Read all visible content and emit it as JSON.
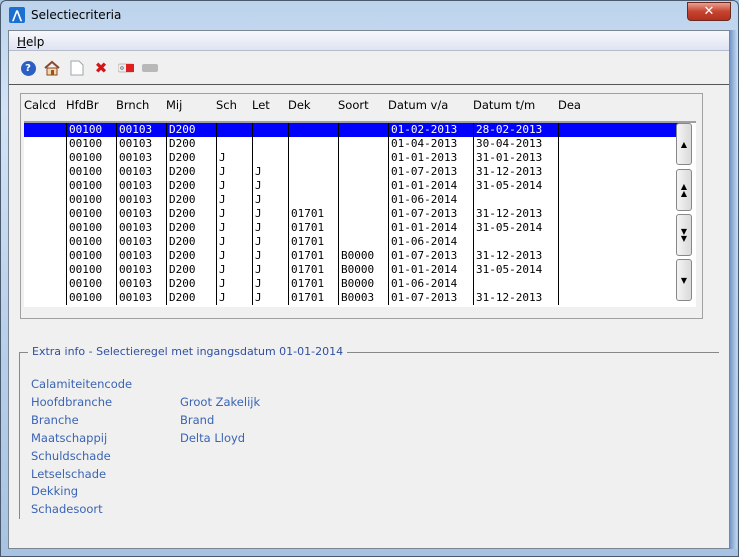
{
  "window": {
    "title": "Selectiecriteria",
    "close": "✕"
  },
  "menu": {
    "help": "Help"
  },
  "toolbar": [
    "help-icon",
    "home-icon",
    "new-document-icon",
    "delete-icon",
    "toggle-on-icon",
    "toggle-off-icon"
  ],
  "table": {
    "headers": [
      "Calcd",
      "HfdBr",
      "Brnch",
      "Mij",
      "Sch",
      "Let",
      "Dek",
      "Soort",
      "Datum v/a",
      "Datum t/m",
      "Dea"
    ],
    "rows": [
      [
        "",
        "00100",
        "00103",
        "D200",
        "",
        "",
        "",
        "",
        "01-02-2013",
        "28-02-2013",
        ""
      ],
      [
        "",
        "00100",
        "00103",
        "D200",
        "",
        "",
        "",
        "",
        "01-04-2013",
        "30-04-2013",
        ""
      ],
      [
        "",
        "00100",
        "00103",
        "D200",
        "J",
        "",
        "",
        "",
        "01-01-2013",
        "31-01-2013",
        ""
      ],
      [
        "",
        "00100",
        "00103",
        "D200",
        "J",
        "J",
        "",
        "",
        "01-07-2013",
        "31-12-2013",
        ""
      ],
      [
        "",
        "00100",
        "00103",
        "D200",
        "J",
        "J",
        "",
        "",
        "01-01-2014",
        "31-05-2014",
        ""
      ],
      [
        "",
        "00100",
        "00103",
        "D200",
        "J",
        "J",
        "",
        "",
        "01-06-2014",
        "",
        ""
      ],
      [
        "",
        "00100",
        "00103",
        "D200",
        "J",
        "J",
        "01701",
        "",
        "01-07-2013",
        "31-12-2013",
        ""
      ],
      [
        "",
        "00100",
        "00103",
        "D200",
        "J",
        "J",
        "01701",
        "",
        "01-01-2014",
        "31-05-2014",
        ""
      ],
      [
        "",
        "00100",
        "00103",
        "D200",
        "J",
        "J",
        "01701",
        "",
        "01-06-2014",
        "",
        ""
      ],
      [
        "",
        "00100",
        "00103",
        "D200",
        "J",
        "J",
        "01701",
        "B0000",
        "01-07-2013",
        "31-12-2013",
        ""
      ],
      [
        "",
        "00100",
        "00103",
        "D200",
        "J",
        "J",
        "01701",
        "B0000",
        "01-01-2014",
        "31-05-2014",
        ""
      ],
      [
        "",
        "00100",
        "00103",
        "D200",
        "J",
        "J",
        "01701",
        "B0000",
        "01-06-2014",
        "",
        ""
      ],
      [
        "",
        "00100",
        "00103",
        "D200",
        "J",
        "J",
        "01701",
        "B0003",
        "01-07-2013",
        "31-12-2013",
        ""
      ]
    ],
    "selected_row": 0
  },
  "extra": {
    "title": "Extra info - Selectieregel met ingangsdatum 01-01-2014",
    "fields": [
      {
        "label": "Calamiteitencode",
        "value": ""
      },
      {
        "label": "Hoofdbranche",
        "value": "Groot Zakelijk"
      },
      {
        "label": "Branche",
        "value": "Brand"
      },
      {
        "label": "Maatschappij",
        "value": "Delta Lloyd"
      },
      {
        "label": "Schuldschade",
        "value": ""
      },
      {
        "label": "Letselschade",
        "value": ""
      },
      {
        "label": "Dekking",
        "value": ""
      },
      {
        "label": "Schadesoort",
        "value": ""
      }
    ]
  }
}
